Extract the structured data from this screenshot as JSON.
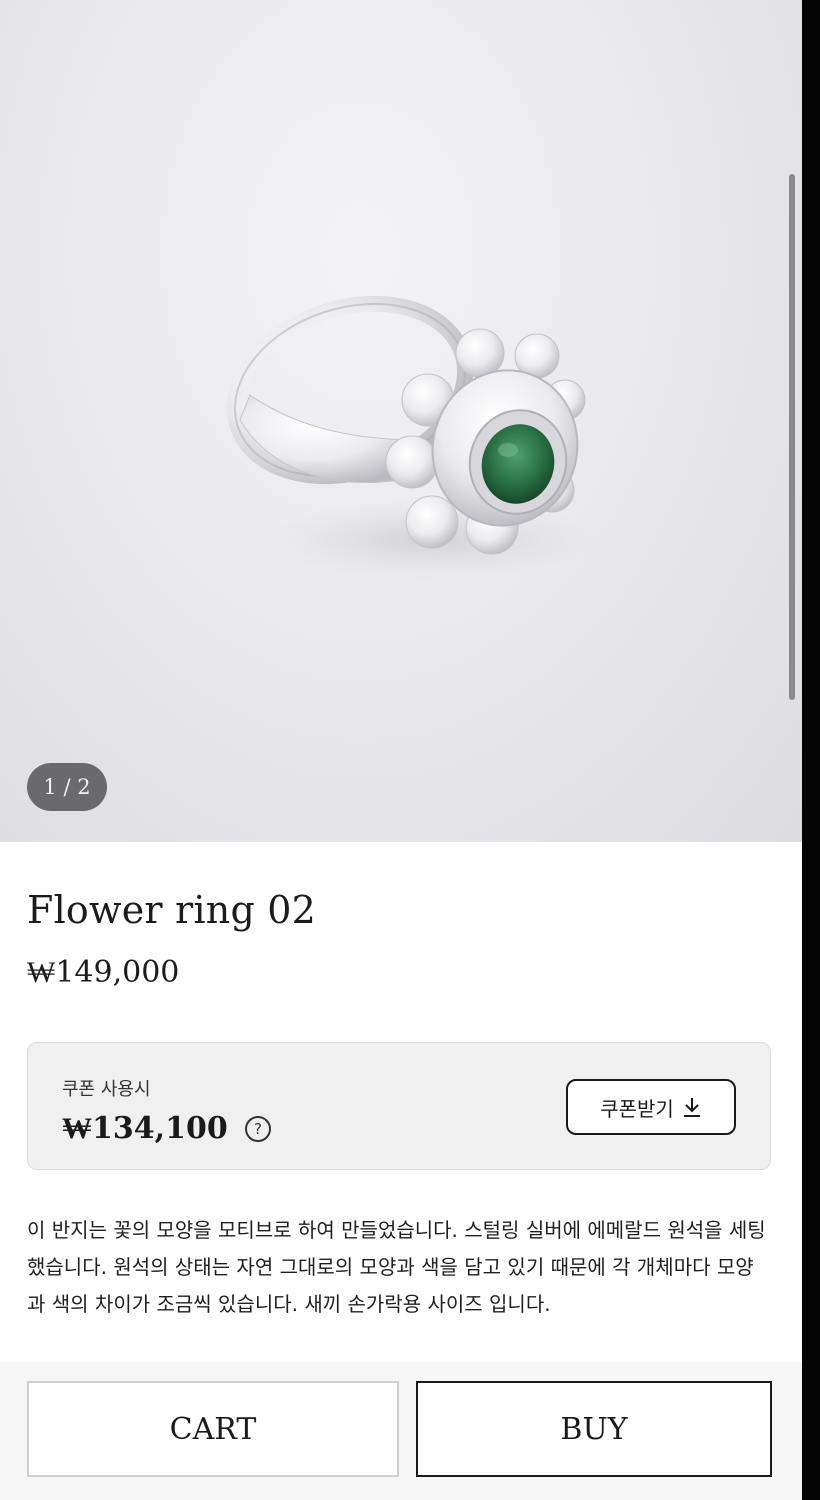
{
  "gallery": {
    "counter": "1 / 2"
  },
  "product": {
    "name": "Flower ring 02",
    "price": "₩149,000"
  },
  "coupon": {
    "label": "쿠폰 사용시",
    "price": "₩134,100",
    "help_glyph": "?",
    "button_label": "쿠폰받기"
  },
  "description": "이 반지는 꽃의 모양을 모티브로 하여 만들었습니다. 스털링 실버에 에메랄드 원석을 세팅했습니다. 원석의 상태는 자연 그대로의 모양과 색을 담고 있기 때문에 각 개체마다 모양과 색의 차이가 조금씩 있습니다. 새끼 손가락용 사이즈 입니다.",
  "actions": {
    "cart_label": "CART",
    "buy_label": "BUY"
  },
  "colors": {
    "accent_gem": "#2e7d4a",
    "text": "#1a1a1a",
    "silver": "#e6e6ea"
  },
  "icons": {
    "help": "help-circle-icon",
    "download": "download-icon"
  }
}
